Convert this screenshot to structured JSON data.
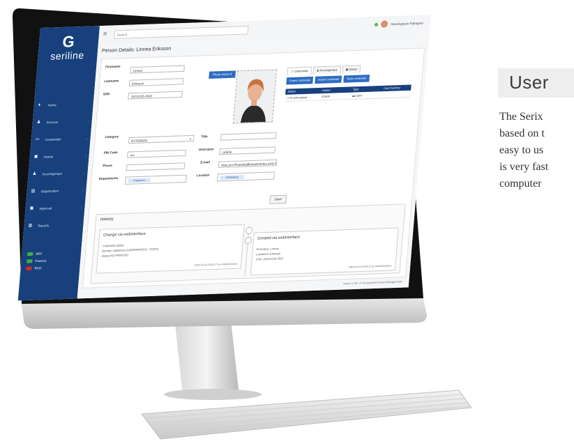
{
  "feature": {
    "heading": "User",
    "lines": [
      "The Serix",
      "based on t",
      "easy to us",
      "is very fast",
      "computer"
    ]
  },
  "app": {
    "logo_text": "seriline",
    "search_placeholder": "Search...",
    "user_name": "Henningsson Palmgren",
    "page_title": "Person Details: Linnea Eriksson",
    "nav": [
      {
        "label": "Home",
        "icon": "home-icon",
        "glyph": "♦"
      },
      {
        "label": "Persons",
        "icon": "person-icon",
        "glyph": "♟"
      },
      {
        "label": "Credentials",
        "icon": "credit-card-icon",
        "glyph": "▭"
      },
      {
        "label": "Assets",
        "icon": "lock-icon",
        "glyph": "▣"
      },
      {
        "label": "Accessgroups",
        "icon": "users-icon",
        "glyph": "♟"
      },
      {
        "label": "Organization",
        "icon": "organization-icon",
        "glyph": "▤"
      },
      {
        "label": "Approval",
        "icon": "approval-icon",
        "glyph": "▣"
      },
      {
        "label": "Reports",
        "icon": "bar-chart-icon",
        "glyph": "▥"
      }
    ],
    "legend": [
      {
        "label": "ARX",
        "color": "#3cb043"
      },
      {
        "label": "Passery",
        "color": "#3cb043"
      },
      {
        "label": "RCO",
        "color": "#d9262a"
      }
    ],
    "form": {
      "firstname_label": "Firstname",
      "firstname": "Linnea",
      "lastname_label": "Lastname",
      "lastname": "Eriksson",
      "ssn_label": "SSN",
      "ssn": "19211126-2642",
      "photo_menu": "Photo menu",
      "category_label": "Category",
      "category": "EXTERNAL",
      "title_label": "Title",
      "title": "",
      "pin_label": "PIN Code",
      "pin": "••••",
      "username_label": "Username",
      "username": "LinErik",
      "phone_label": "Phone",
      "phone": "",
      "email_label": "E-mail",
      "email": "nilse.pro.Pleasdas@auxpersidea.asid.org",
      "departments_label": "Departments",
      "department": "Finances",
      "location_label": "Location",
      "location": "Jonkoping",
      "save_label": "Save"
    },
    "tabs": [
      "Credentials",
      "Accessgroups",
      "Assets"
    ],
    "credential_buttons": [
      "Create credential",
      "Import credential",
      "Temp credential"
    ],
    "credential_table": {
      "headers": [
        "Status",
        "Layout",
        "Type",
        "Card Number"
      ],
      "rows": [
        [
          "In print queue",
          "STAFF",
          "Card",
          ""
        ]
      ]
    },
    "history": {
      "title": "History",
      "left_card": {
        "title": "Change via webinterface",
        "lines": [
          "Credential added",
          "Number undefined (CARDPRINTED - STAFF)",
          "Status NOTPRINTED"
        ],
        "meta": "2018-10-24 23:04:17 by ActiveDirectory"
      },
      "right_card": {
        "title": "Created via webinterface",
        "lines": [
          "Firstname: Linnea",
          "Lastname: Eriksson",
          "SSN: 192111126-2642"
        ],
        "meta": "2018-10-24 23:04:17 by ActiveDirectory"
      }
    },
    "footer": "Serix v1.0b • © Acessystem Asset Management"
  }
}
